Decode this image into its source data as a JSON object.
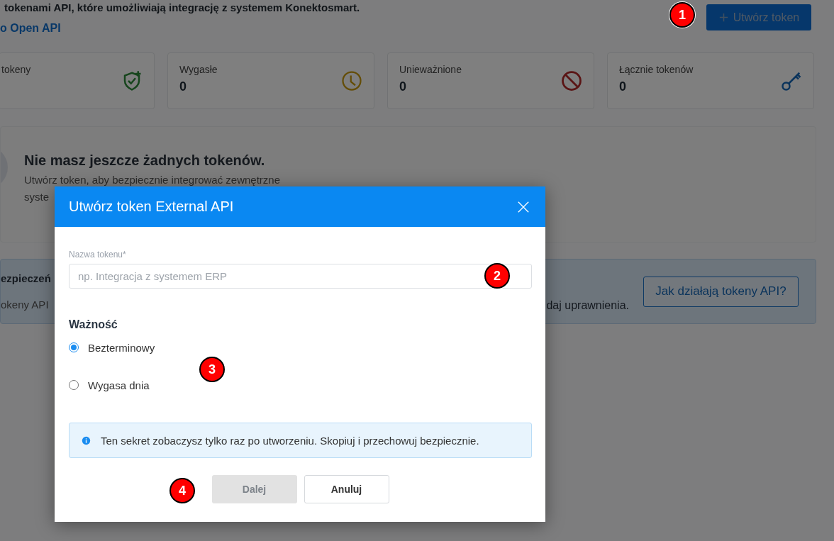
{
  "header": {
    "description": "tokenami API, które umożliwiają integrację z systemem Konektosmart.",
    "link": "o Open API",
    "create_button": "Utwórz token"
  },
  "stats": [
    {
      "label": "tokeny",
      "kind": "active"
    },
    {
      "label": "Wygasłe",
      "value": "0",
      "kind": "expired"
    },
    {
      "label": "Unieważnione",
      "value": "0",
      "kind": "revoked"
    },
    {
      "label": "Łącznie tokenów",
      "value": "0",
      "kind": "total"
    }
  ],
  "empty_state": {
    "title": "Nie masz jeszcze żadnych tokenów.",
    "text_line_1": "Utwórz token, aby bezpiecznie integrować zewnętrzne",
    "text_line_2": "syste"
  },
  "info_banner": {
    "title": "ezpieczeń",
    "text_left": "okeny API",
    "text_right": "daj uprawnienia.",
    "button": "Jak działają tokeny API?"
  },
  "dialog": {
    "title": "Utwórz token External API",
    "field": {
      "label": "Nazwa tokenu*",
      "placeholder": "np. Integracja z systemem ERP"
    },
    "validity": {
      "heading": "Ważność",
      "options": [
        {
          "label": "Bezterminowy",
          "selected": true
        },
        {
          "label": "Wygasa dnia",
          "selected": false
        }
      ]
    },
    "notice": "Ten sekret zobaczysz tylko raz po utworzeniu. Skopiuj i przechowuj bezpiecznie.",
    "buttons": [
      {
        "label": "Dalej",
        "kind": "primary",
        "disabled": true
      },
      {
        "label": "Anuluj",
        "kind": "secondary",
        "disabled": false
      }
    ]
  },
  "markers": [
    "1",
    "2",
    "3",
    "4"
  ]
}
